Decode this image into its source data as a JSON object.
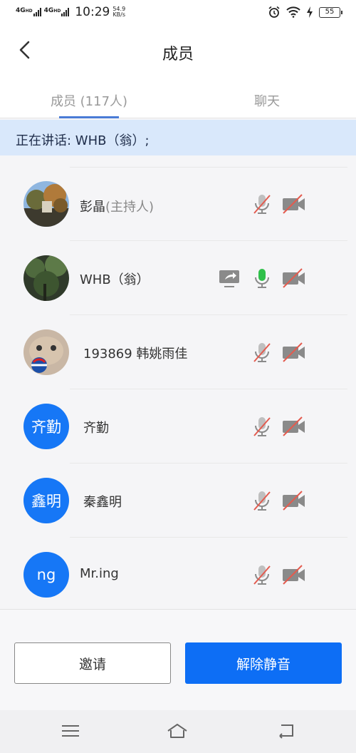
{
  "status_bar": {
    "network1": "4G",
    "network1_sup": "HD",
    "network2": "4G",
    "network2_sup": "HD",
    "time": "10:29",
    "speed_value": "54.9",
    "speed_unit": "KB/s",
    "battery": "55",
    "icons": [
      "alarm-icon",
      "wifi-icon",
      "charging-icon",
      "battery-icon"
    ]
  },
  "header": {
    "title": "成员",
    "back_icon": "chevron-left-icon"
  },
  "tabs": [
    {
      "label": "成员 (117人)",
      "active": true
    },
    {
      "label": "聊天",
      "active": false
    }
  ],
  "speaking": {
    "text": "正在讲话: WHB（翁）;"
  },
  "members": [
    {
      "name": "彭晶",
      "role": "(主持人)",
      "avatar": "photo-trees",
      "mic": "muted",
      "camera": "off",
      "sharing": false
    },
    {
      "name": "WHB（翁）",
      "role": "",
      "avatar": "photo-forest",
      "mic": "active",
      "camera": "off",
      "sharing": true
    },
    {
      "name": "193869 韩姚雨佳",
      "role": "",
      "avatar": "photo-cat",
      "mic": "muted",
      "camera": "off",
      "sharing": false
    },
    {
      "name": "齐勤",
      "role": "",
      "avatar_text": "齐勤",
      "mic": "muted",
      "camera": "off",
      "sharing": false
    },
    {
      "name": "秦鑫明",
      "role": "",
      "avatar_text": "鑫明",
      "mic": "muted",
      "camera": "off",
      "sharing": false
    },
    {
      "name": "Mr.ing",
      "role": "",
      "avatar_text": "ng",
      "mic": "muted",
      "camera": "off",
      "sharing": false
    }
  ],
  "buttons": {
    "invite": "邀请",
    "unmute_all": "解除静音"
  },
  "nav": {
    "icons": [
      "menu-icon",
      "home-icon",
      "back-icon"
    ]
  },
  "colors": {
    "primary": "#0d6ef5",
    "banner": "#d9e8fb",
    "muted_slash": "#e35b4f",
    "mic_active": "#2fc04a"
  }
}
